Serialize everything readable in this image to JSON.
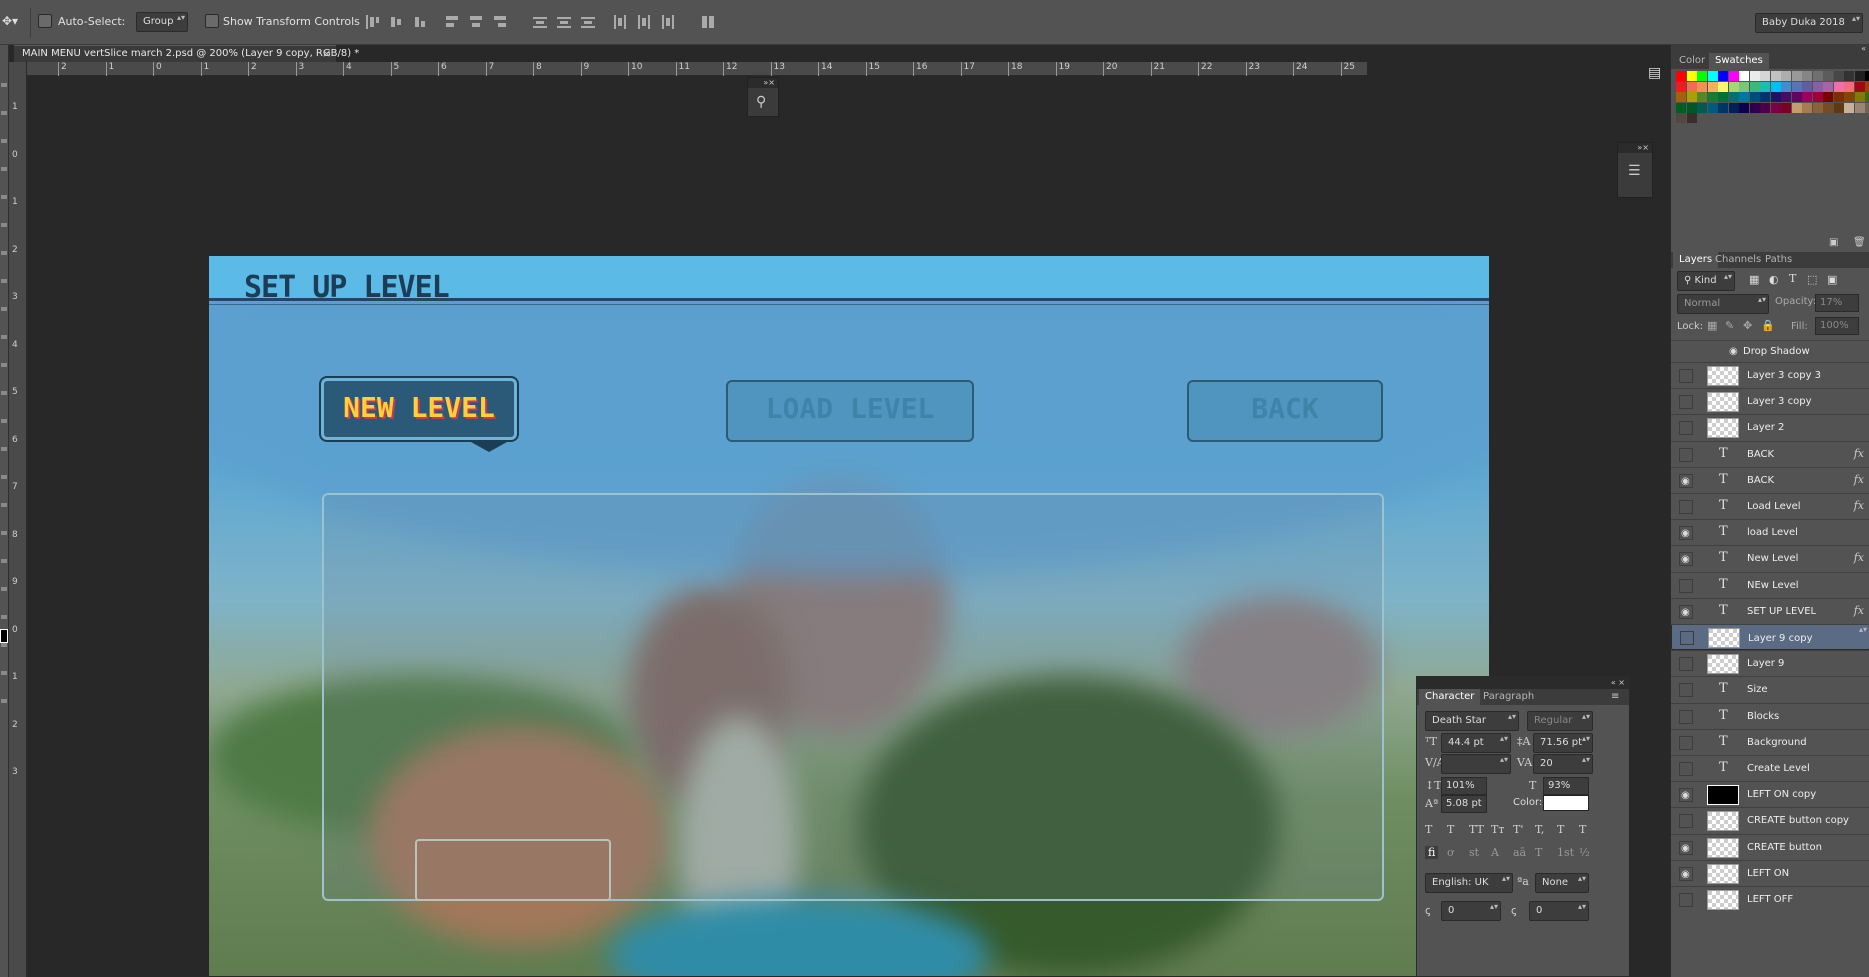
{
  "options_bar": {
    "auto_select_label": "Auto-Select:",
    "auto_select_value": "Group",
    "show_transform_label": "Show Transform Controls",
    "workspace": "Baby Duka 2018"
  },
  "document": {
    "tab_title": "MAIN MENU vertSlice march 2.psd @ 200% (Layer 9 copy, RGB/8) *",
    "close_glyph": "×"
  },
  "ruler_h": [
    "2",
    "1",
    "0",
    "1",
    "2",
    "3",
    "4",
    "5",
    "6",
    "7",
    "8",
    "9",
    "10",
    "11",
    "12",
    "13",
    "14",
    "15",
    "16",
    "17",
    "18",
    "19",
    "20",
    "21",
    "22",
    "23",
    "24",
    "25"
  ],
  "ruler_v": [
    "1",
    "0",
    "1",
    "2",
    "3",
    "4",
    "5",
    "6",
    "7",
    "8",
    "9",
    "0",
    "1",
    "2",
    "3"
  ],
  "game_ui": {
    "header_title": "SET UP LEVEL",
    "new_level": "NEW LEVEL",
    "load_level": "LOAD LEVEL",
    "back": "BACK"
  },
  "right_dock": {
    "top_tabs": [
      "Color",
      "Swatches"
    ],
    "layer_tabs": [
      "Layers",
      "Channels",
      "Paths"
    ],
    "kind_label": "Kind",
    "blend_mode": "Normal",
    "opacity_label": "Opacity:",
    "opacity_value": "17%",
    "lock_label": "Lock:",
    "fill_label": "Fill:",
    "fill_value": "100%",
    "effect_label": "Drop Shadow",
    "swatch_colors": [
      "#ff0000",
      "#ffff00",
      "#00ff00",
      "#00ffff",
      "#0000ff",
      "#ff00ff",
      "#ffffff",
      "#ebebeb",
      "#d6d6d6",
      "#c2c2c2",
      "#adadad",
      "#999999",
      "#858585",
      "#707070",
      "#5c5c5c",
      "#474747",
      "#333333",
      "#1f1f1f",
      "#000000",
      "#ed1c24",
      "#f26c4f",
      "#f68e56",
      "#fbaf5d",
      "#fff568",
      "#acd373",
      "#7cc576",
      "#3cb878",
      "#1cbbb4",
      "#00bff3",
      "#448ccb",
      "#5674b9",
      "#605ca8",
      "#855fa8",
      "#a864a8",
      "#f06ea9",
      "#f26d7d",
      "#9e0b0f",
      "#a0410d",
      "#a3620a",
      "#aba000",
      "#598527",
      "#1a7b30",
      "#007236",
      "#00746b",
      "#0076a3",
      "#004b80",
      "#003471",
      "#1b1464",
      "#440e62",
      "#630460",
      "#9e005d",
      "#9e0039",
      "#790000",
      "#7b2e00",
      "#7d4900",
      "#827b00",
      "#406618",
      "#005e20",
      "#005826",
      "#005952",
      "#005b7f",
      "#003663",
      "#002157",
      "#0d004c",
      "#32004b",
      "#4b0049",
      "#7b0046",
      "#7a0026",
      "#c69c6d",
      "#a67c52",
      "#8c6239",
      "#754c24",
      "#603913",
      "#c7b299",
      "#998675",
      "#736357",
      "#534741",
      "#37302a"
    ]
  },
  "layers": [
    {
      "name": "Layer 3 copy 3",
      "kind": "pixel",
      "visible": false,
      "fx": false
    },
    {
      "name": "Layer 3 copy",
      "kind": "pixel",
      "visible": false,
      "fx": false
    },
    {
      "name": "Layer 2",
      "kind": "pixel",
      "visible": false,
      "fx": false
    },
    {
      "name": "BACK",
      "kind": "text",
      "visible": false,
      "fx": true
    },
    {
      "name": "BACK",
      "kind": "text",
      "visible": true,
      "fx": true
    },
    {
      "name": "Load Level",
      "kind": "text",
      "visible": false,
      "fx": true
    },
    {
      "name": "load  Level",
      "kind": "text",
      "visible": true,
      "fx": false
    },
    {
      "name": "New Level",
      "kind": "text",
      "visible": true,
      "fx": true
    },
    {
      "name": "NEw  Level",
      "kind": "text",
      "visible": false,
      "fx": false
    },
    {
      "name": "SET UP LEVEL",
      "kind": "text",
      "visible": true,
      "fx": true
    },
    {
      "name": "Layer 9 copy",
      "kind": "pixel",
      "visible": false,
      "fx": false,
      "selected": true
    },
    {
      "name": "Layer 9",
      "kind": "pixel",
      "visible": false,
      "fx": false
    },
    {
      "name": "Size",
      "kind": "text",
      "visible": false,
      "fx": false
    },
    {
      "name": "Blocks",
      "kind": "text",
      "visible": false,
      "fx": false
    },
    {
      "name": "Background",
      "kind": "text",
      "visible": false,
      "fx": false
    },
    {
      "name": "Create Level",
      "kind": "text",
      "visible": false,
      "fx": false
    },
    {
      "name": "LEFT ON copy",
      "kind": "pixel-dark",
      "visible": true,
      "fx": false
    },
    {
      "name": "CREATE button copy",
      "kind": "pixel",
      "visible": false,
      "fx": false
    },
    {
      "name": "CREATE button",
      "kind": "pixel",
      "visible": true,
      "fx": false
    },
    {
      "name": "LEFT ON",
      "kind": "pixel",
      "visible": true,
      "fx": false
    },
    {
      "name": "LEFT OFF",
      "kind": "pixel",
      "visible": false,
      "fx": false
    }
  ],
  "character_panel": {
    "tabs": [
      "Character",
      "Paragraph"
    ],
    "font_family": "Death Star",
    "font_style": "Regular",
    "font_size": "44.4 pt",
    "leading": "71.56 pt",
    "kerning": "",
    "tracking": "20",
    "vertical_scale": "101%",
    "horizontal_scale": "93%",
    "baseline_shift": "5.08 pt",
    "color_label": "Color:",
    "language": "English: UK",
    "antialias": "None",
    "style_buttons": [
      "T",
      "T",
      "TT",
      "Tт",
      "T'",
      "T,",
      "T",
      "T"
    ],
    "opentype_buttons": [
      "fi",
      "ơ",
      "st",
      "A",
      "aā",
      "T",
      "1st",
      "½"
    ],
    "bottom_left_value": "0",
    "bottom_right_value": "0"
  }
}
